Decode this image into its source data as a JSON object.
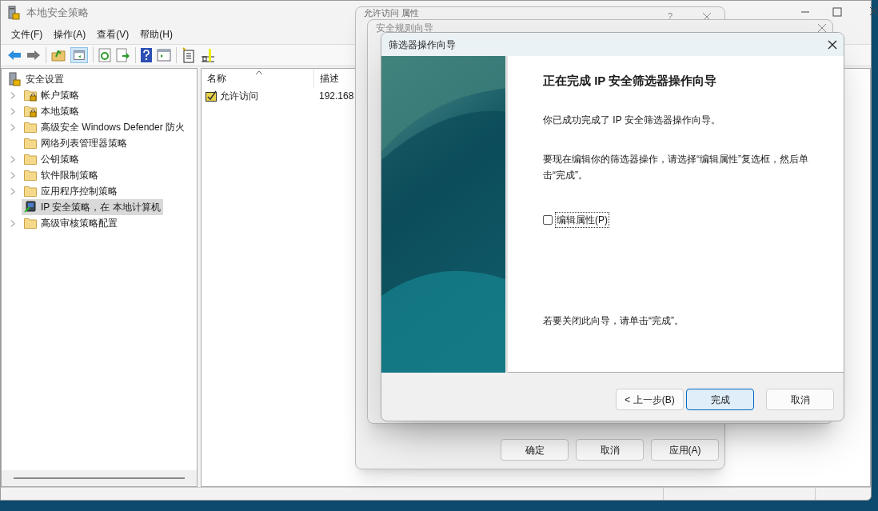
{
  "main_window": {
    "title": "本地安全策略",
    "menu": [
      "文件(F)",
      "操作(A)",
      "查看(V)",
      "帮助(H)"
    ],
    "tree": {
      "label": "安全设置",
      "children": [
        {
          "label": "帐户策略",
          "expandable": true,
          "kind": "lock-folder",
          "selected": false
        },
        {
          "label": "本地策略",
          "expandable": true,
          "kind": "lock-folder",
          "selected": false
        },
        {
          "label": "高级安全 Windows Defender 防火",
          "expandable": true,
          "kind": "folder",
          "selected": false
        },
        {
          "label": "网络列表管理器策略",
          "expandable": false,
          "kind": "folder",
          "selected": false
        },
        {
          "label": "公钥策略",
          "expandable": true,
          "kind": "folder",
          "selected": false
        },
        {
          "label": "软件限制策略",
          "expandable": true,
          "kind": "folder",
          "selected": false
        },
        {
          "label": "应用程序控制策略",
          "expandable": true,
          "kind": "folder",
          "selected": false
        },
        {
          "label": "IP 安全策略，在 本地计算机",
          "expandable": false,
          "kind": "ip-policy",
          "selected": true
        },
        {
          "label": "高级审核策略配置",
          "expandable": true,
          "kind": "folder",
          "selected": false
        }
      ]
    },
    "list": {
      "columns": [
        "名称",
        "描述"
      ],
      "rows": [
        {
          "name": "允许访问",
          "description": "192.168"
        }
      ]
    }
  },
  "properties_dialog": {
    "title": "允许访问 属性",
    "help": "?",
    "buttons": [
      "确定",
      "取消",
      "应用(A)"
    ]
  },
  "rule_wizard": {
    "title": "安全规则向导"
  },
  "filter_wizard": {
    "title": "筛选器操作向导",
    "heading": "正在完成 IP 安全筛选器操作向导",
    "paragraphs": [
      "你已成功完成了 IP 安全筛选器操作向导。",
      "要现在编辑你的筛选器操作，请选择“编辑属性”复选框，然后单击“完成”。"
    ],
    "checkbox": {
      "label": "编辑属性(P)",
      "checked": false
    },
    "closing_note": "若要关闭此向导，请单击“完成”。",
    "buttons": [
      {
        "label": "< 上一步(B)",
        "default": false
      },
      {
        "label": "完成",
        "default": true
      },
      {
        "label": "取消",
        "default": false
      }
    ]
  }
}
